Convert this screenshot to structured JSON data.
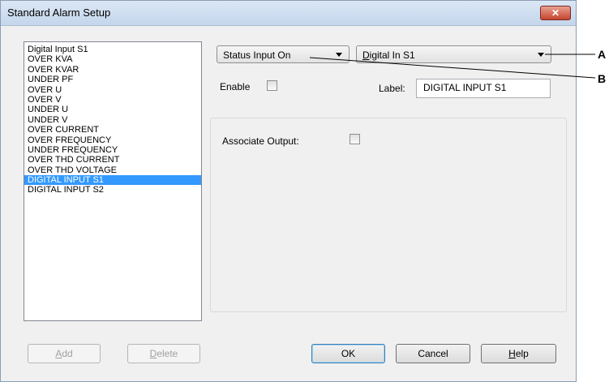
{
  "window": {
    "title": "Standard Alarm Setup"
  },
  "alarm_list": {
    "items": [
      "Digital Input S1",
      "OVER KVA",
      "OVER KVAR",
      "UNDER PF",
      "OVER U",
      "OVER V",
      "UNDER U",
      "UNDER V",
      "OVER CURRENT",
      "OVER FREQUENCY",
      "UNDER FREQUENCY",
      "OVER THD CURRENT",
      "OVER THD VOLTAGE",
      "DIGITAL INPUT S1",
      "DIGITAL INPUT S2"
    ],
    "selected_item": "DIGITAL INPUT S1"
  },
  "condition_combo": {
    "value": "Status Input On"
  },
  "input_combo": {
    "value_prefix": "",
    "value_underlined": "D",
    "value_rest": "igital In S1"
  },
  "enable": {
    "label": "Enable",
    "checked": false
  },
  "label_field": {
    "label": "Label:",
    "value": "DIGITAL INPUT S1"
  },
  "associate_output": {
    "label": "Associate Output:",
    "checked": false
  },
  "buttons": {
    "add": {
      "underlined": "A",
      "rest": "dd"
    },
    "delete": {
      "underlined": "D",
      "rest": "elete"
    },
    "ok": {
      "label": "OK"
    },
    "cancel": {
      "label": "Cancel"
    },
    "help": {
      "underlined": "H",
      "rest": "elp"
    }
  },
  "callouts": {
    "a": "A",
    "b": "B"
  },
  "icons": {
    "close": "close-icon",
    "dropdown": "chevron-down-icon"
  }
}
